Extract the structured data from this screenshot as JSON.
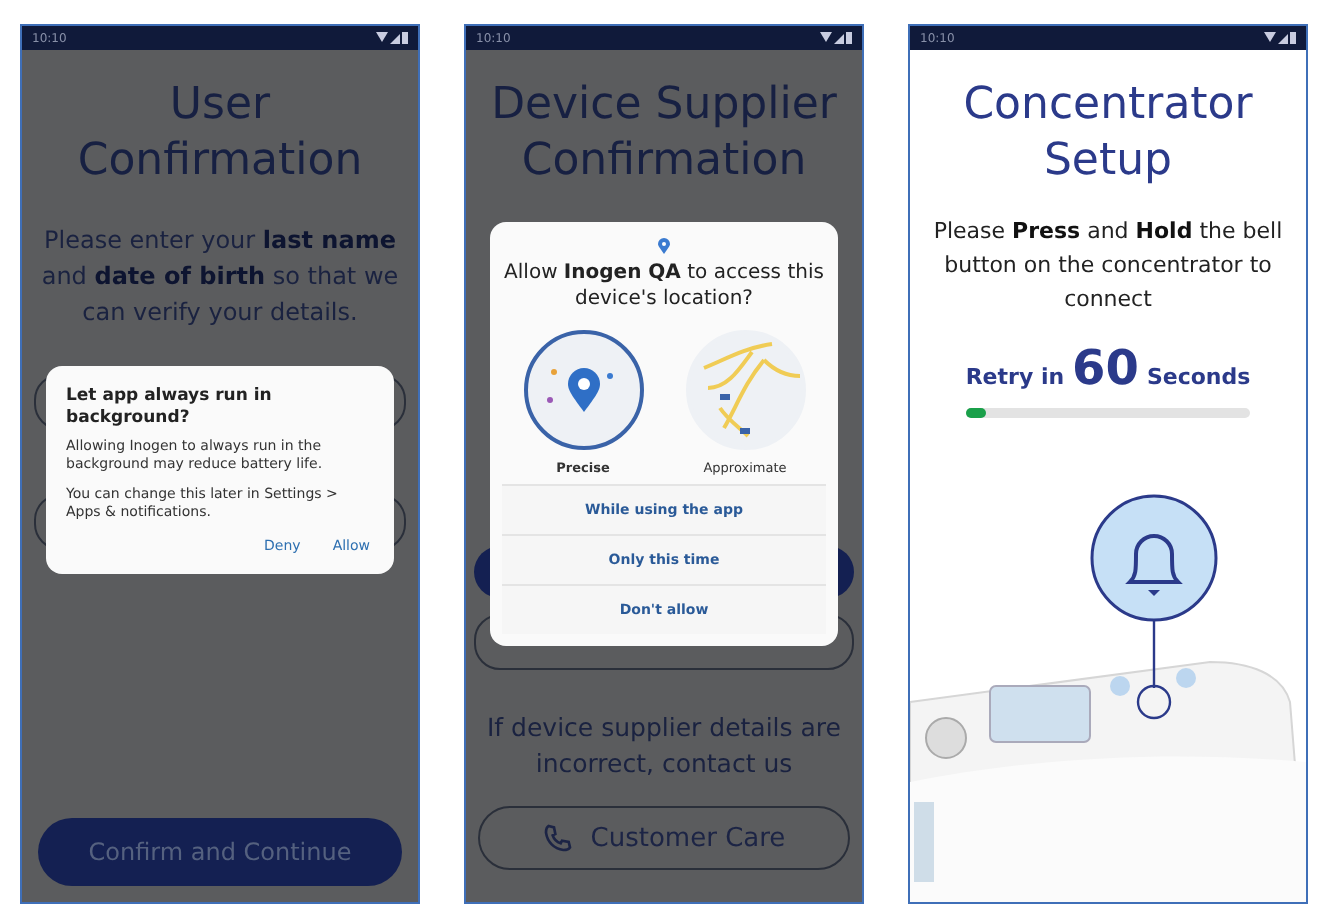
{
  "screens": [
    {
      "kind": "form",
      "status_time": "10:10",
      "title": "User Confirmation",
      "message": "Please enter your **last name** and **date of birth** so that we can verify your details.",
      "primary_button": "Confirm and Continue",
      "dialog": {
        "kind": "notice",
        "title": "Let app always run in background?",
        "body": [
          "Allowing Inogen to always run in the background may reduce battery life.",
          "You can change this later in Settings > Apps & notifications."
        ],
        "actions": [
          "Deny",
          "Allow"
        ]
      }
    },
    {
      "kind": "supplier",
      "status_time": "10:10",
      "title": "Device Supplier Confirmation",
      "message": "If device supplier details are incorrect, contact us",
      "secondary_button": "Customer Care",
      "dialog": {
        "kind": "location",
        "title": "Allow **Inogen QA** to access this device's location?",
        "options": [
          {
            "label": "Precise",
            "selected": true
          },
          {
            "label": "Approximate",
            "selected": false
          }
        ],
        "actions": [
          "While using the app",
          "Only this time",
          "Don't allow"
        ]
      }
    },
    {
      "kind": "setup",
      "status_time": "10:10",
      "title": "Concentrator Setup",
      "message": "Please **Press** and **Hold** the bell button on the concentrator to connect",
      "retry": {
        "prefix": "Retry in",
        "count": "60",
        "suffix": "Seconds"
      },
      "progress": {
        "level": 0.07
      }
    }
  ]
}
